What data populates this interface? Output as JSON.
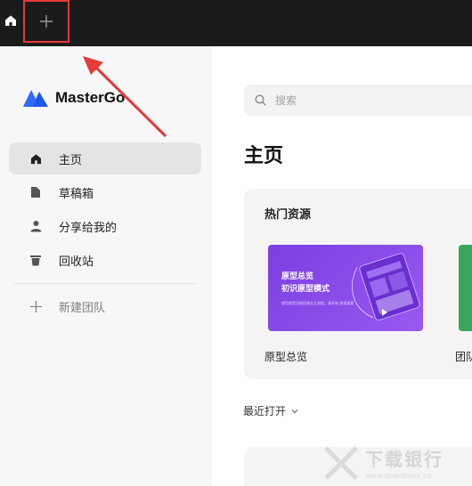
{
  "app": {
    "brand": "MasterGo"
  },
  "tabs": {
    "home_icon": "home-icon",
    "add_icon": "plus-icon"
  },
  "sidebar": {
    "items": [
      {
        "label": "主页",
        "icon": "home-icon",
        "active": true
      },
      {
        "label": "草稿箱",
        "icon": "file-icon",
        "active": false
      },
      {
        "label": "分享给我的",
        "icon": "user-icon",
        "active": false
      },
      {
        "label": "回收站",
        "icon": "trash-icon",
        "active": false
      }
    ],
    "new_team": "新建团队"
  },
  "search": {
    "placeholder": "搜索"
  },
  "main": {
    "title": "主页",
    "hot": {
      "title": "热门资源",
      "cards": [
        {
          "caption": "原型总览",
          "thumb_title": "原型总览",
          "thumb_subtitle": "初识原型模式",
          "thumb_small": "使用原型功能搭建交互流程，请开始 快速查看"
        },
        {
          "caption": "团队"
        }
      ]
    },
    "recent_label": "最近打开"
  },
  "watermark": {
    "main": "下载银行",
    "sub": "www.downbank.cn"
  },
  "colors": {
    "accent_arrow": "#e53935",
    "logo_blue": "#2f6bff",
    "thumb_purple": "#8a4bec"
  }
}
